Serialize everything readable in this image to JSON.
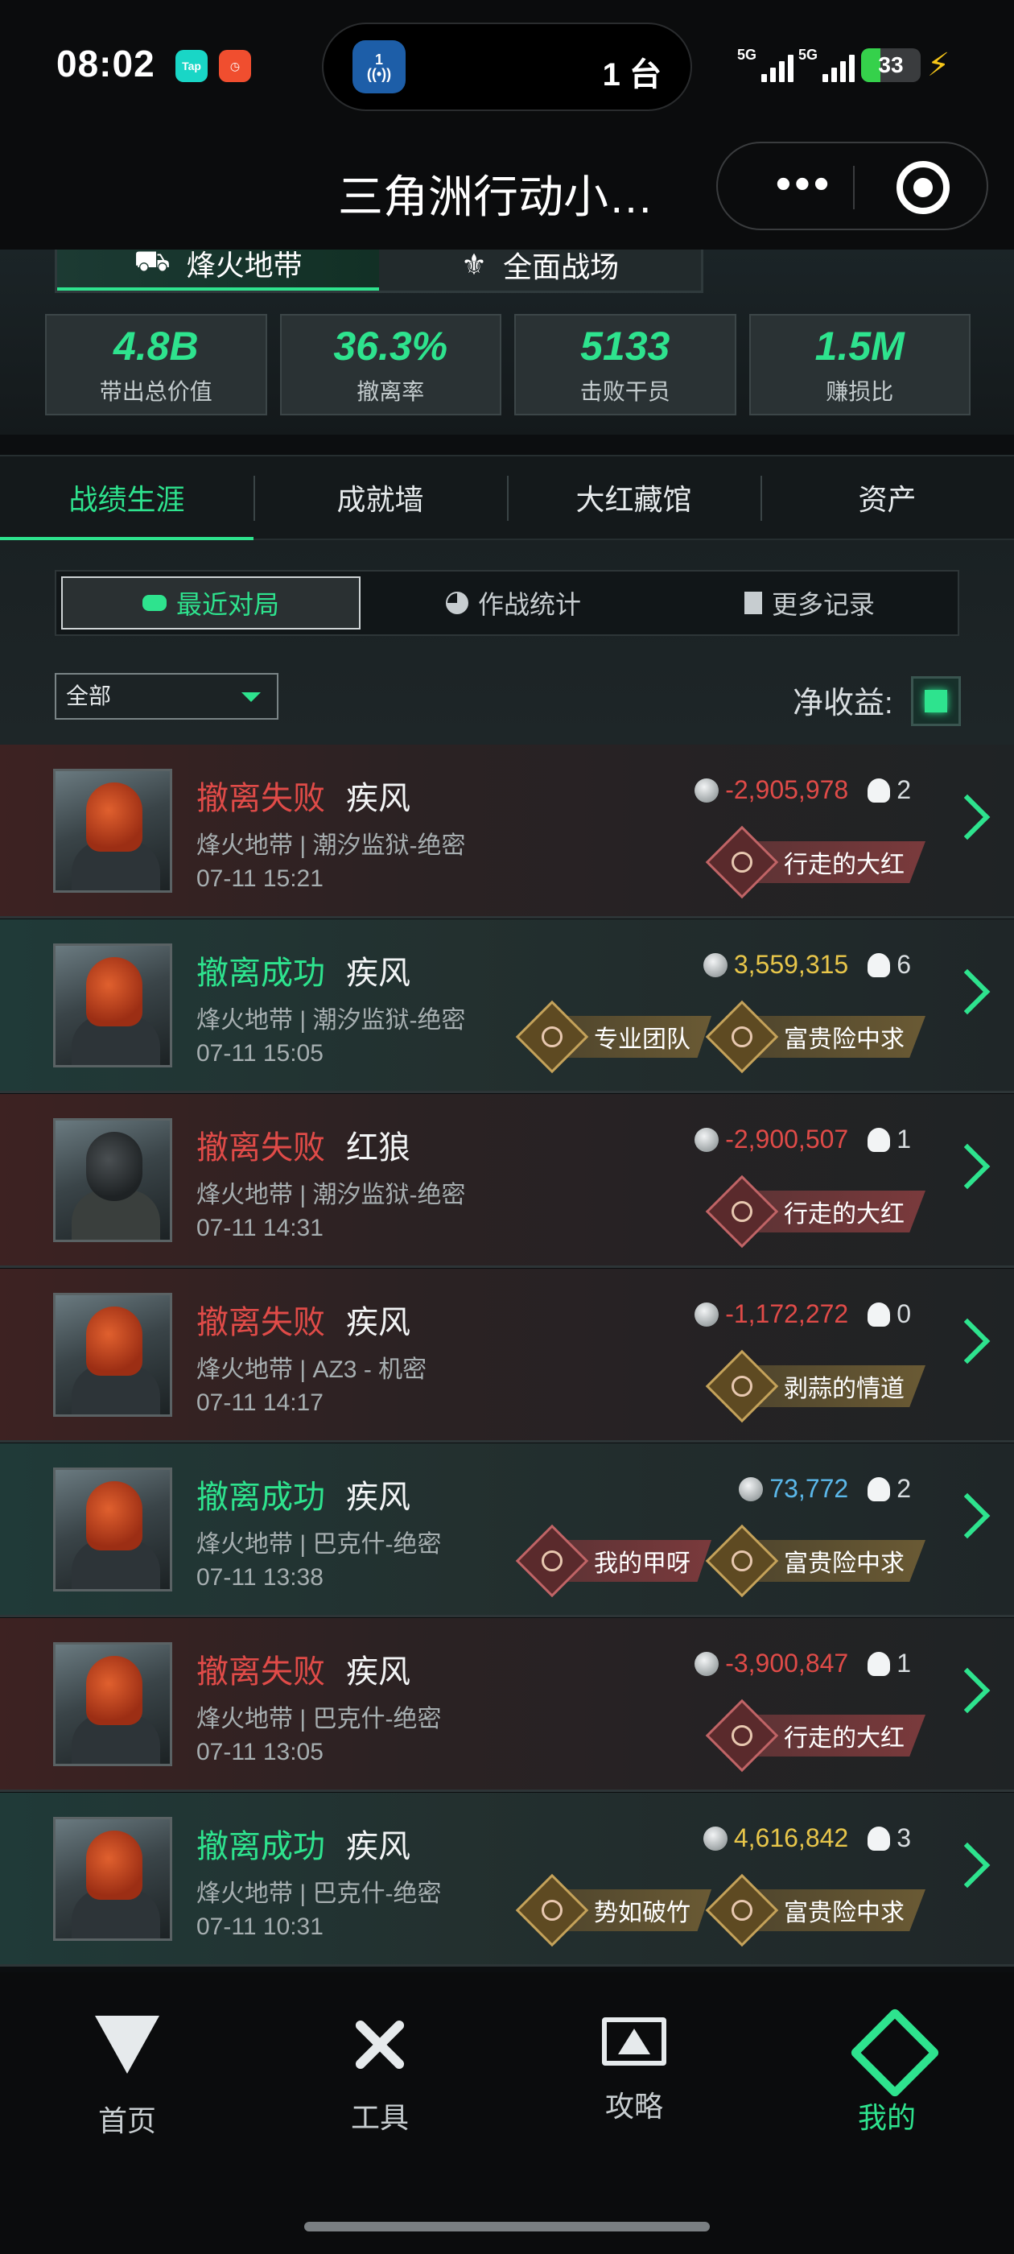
{
  "status_bar": {
    "time": "08:02",
    "app_badges": [
      "Tap",
      ""
    ],
    "island_badge": "1",
    "island_text": "1 台",
    "signal_labels": [
      "5G",
      "5G"
    ],
    "battery": "33",
    "battery_level": 0.33
  },
  "nav": {
    "title": "三角洲行动小…",
    "more_icon": "more-dots-icon",
    "close_icon": "target-close-icon"
  },
  "summary": {
    "modes": [
      {
        "label": "烽火地带",
        "active": true
      },
      {
        "label": "全面战场",
        "active": false
      }
    ],
    "stats": [
      {
        "value": "4.8B",
        "label": "带出总价值"
      },
      {
        "value": "36.3%",
        "label": "撤离率"
      },
      {
        "value": "5133",
        "label": "击败干员"
      },
      {
        "value": "1.5M",
        "label": "赚损比"
      }
    ]
  },
  "main_tabs": [
    "战绩生涯",
    "成就墙",
    "大红藏馆",
    "资产"
  ],
  "sub_tabs": [
    "最近对局",
    "作战统计",
    "更多记录"
  ],
  "filter": {
    "selected": "全部"
  },
  "net_income_label": "净收益:",
  "matches": [
    {
      "result": "撤离失败",
      "status": "fail",
      "operator": "疾风",
      "map": "烽火地带 | 潮汐监狱-绝密",
      "time": "07-11 15:21",
      "value": "-2,905,978",
      "value_style": "neg",
      "kills": "2",
      "tags": [
        {
          "label": "行走的大红",
          "style": "red"
        }
      ]
    },
    {
      "result": "撤离成功",
      "status": "success",
      "operator": "疾风",
      "map": "烽火地带 | 潮汐监狱-绝密",
      "time": "07-11 15:05",
      "value": "3,559,315",
      "value_style": "gold",
      "kills": "6",
      "tags": [
        {
          "label": "专业团队",
          "style": "gold"
        },
        {
          "label": "富贵险中求",
          "style": "gold"
        }
      ]
    },
    {
      "result": "撤离失败",
      "status": "fail",
      "operator": "红狼",
      "map": "烽火地带 | 潮汐监狱-绝密",
      "time": "07-11 14:31",
      "value": "-2,900,507",
      "value_style": "neg",
      "kills": "1",
      "tags": [
        {
          "label": "行走的大红",
          "style": "red"
        }
      ]
    },
    {
      "result": "撤离失败",
      "status": "fail",
      "operator": "疾风",
      "map": "烽火地带 | AZ3 - 机密",
      "time": "07-11 14:17",
      "value": "-1,172,272",
      "value_style": "neg",
      "kills": "0",
      "tags": [
        {
          "label": "剥蒜的情道",
          "style": "gold"
        }
      ]
    },
    {
      "result": "撤离成功",
      "status": "success",
      "operator": "疾风",
      "map": "烽火地带 | 巴克什-绝密",
      "time": "07-11 13:38",
      "value": "73,772",
      "value_style": "blue",
      "kills": "2",
      "tags": [
        {
          "label": "我的甲呀",
          "style": "red"
        },
        {
          "label": "富贵险中求",
          "style": "gold"
        }
      ]
    },
    {
      "result": "撤离失败",
      "status": "fail",
      "operator": "疾风",
      "map": "烽火地带 | 巴克什-绝密",
      "time": "07-11 13:05",
      "value": "-3,900,847",
      "value_style": "neg",
      "kills": "1",
      "tags": [
        {
          "label": "行走的大红",
          "style": "red"
        }
      ]
    },
    {
      "result": "撤离成功",
      "status": "success",
      "operator": "疾风",
      "map": "烽火地带 | 巴克什-绝密",
      "time": "07-11 10:31",
      "value": "4,616,842",
      "value_style": "gold",
      "kills": "3",
      "tags": [
        {
          "label": "势如破竹",
          "style": "gold"
        },
        {
          "label": "富贵险中求",
          "style": "gold"
        }
      ]
    }
  ],
  "bottom_nav": [
    {
      "label": "首页",
      "icon": "home-icon"
    },
    {
      "label": "工具",
      "icon": "tools-icon"
    },
    {
      "label": "攻略",
      "icon": "guide-icon"
    },
    {
      "label": "我的",
      "icon": "mine-icon",
      "active": true
    }
  ]
}
